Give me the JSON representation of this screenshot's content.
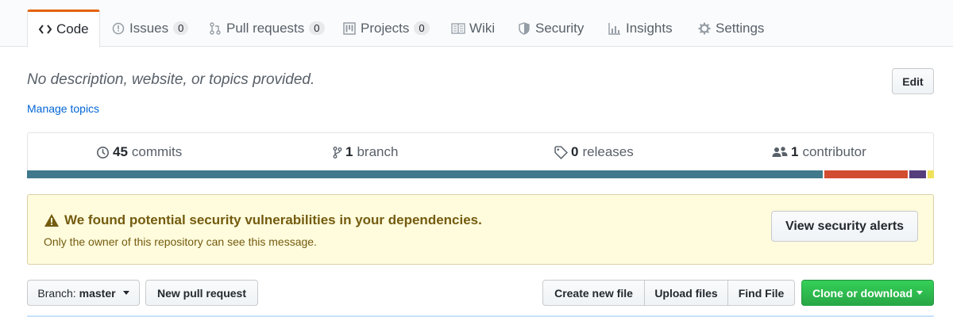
{
  "tabs": [
    {
      "label": "Code",
      "icon": "code-icon",
      "active": true
    },
    {
      "label": "Issues",
      "icon": "issue-icon",
      "count": "0"
    },
    {
      "label": "Pull requests",
      "icon": "pull-request-icon",
      "count": "0"
    },
    {
      "label": "Projects",
      "icon": "project-icon",
      "count": "0"
    },
    {
      "label": "Wiki",
      "icon": "book-icon"
    },
    {
      "label": "Security",
      "icon": "shield-icon"
    },
    {
      "label": "Insights",
      "icon": "graph-icon"
    },
    {
      "label": "Settings",
      "icon": "gear-icon"
    }
  ],
  "repo": {
    "description": "No description, website, or topics provided.",
    "edit_label": "Edit",
    "manage_topics": "Manage topics"
  },
  "stats": {
    "commits_count": "45",
    "commits_label": "commits",
    "branch_count": "1",
    "branch_label": "branch",
    "releases_count": "0",
    "releases_label": "releases",
    "contributors_count": "1",
    "contributors_label": "contributor"
  },
  "language_bar": [
    {
      "color": "#40798c",
      "share": 0.877
    },
    {
      "color": "#d24c31",
      "share": 0.094
    },
    {
      "color": "#563d7c",
      "share": 0.02
    },
    {
      "color": "#f1e05a",
      "share": 0.009
    }
  ],
  "alert": {
    "title": "We found potential security vulnerabilities in your dependencies.",
    "subtitle": "Only the owner of this repository can see this message.",
    "button": "View security alerts"
  },
  "toolbar": {
    "branch_prefix": "Branch:",
    "branch_name": "master",
    "new_pr": "New pull request",
    "create_file": "Create new file",
    "upload_files": "Upload files",
    "find_file": "Find File",
    "clone": "Clone or download"
  },
  "colors": {
    "accent": "#e36209",
    "link": "#0366d6",
    "success": "#28a745",
    "alert_bg": "#fffbdd",
    "alert_text": "#735c0f"
  }
}
